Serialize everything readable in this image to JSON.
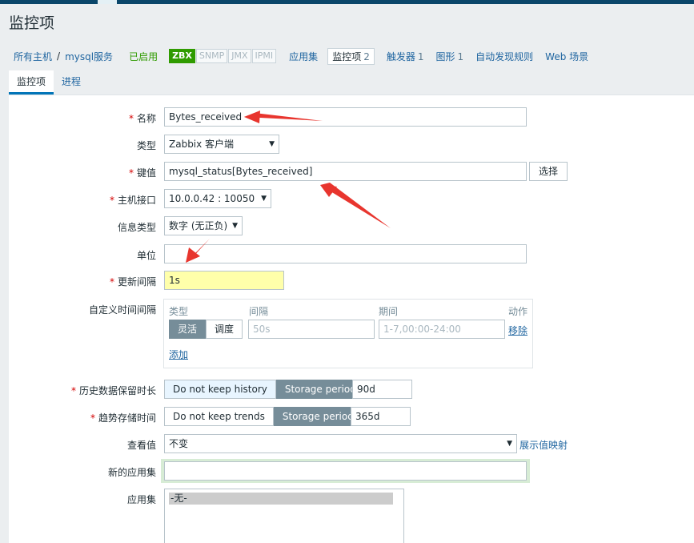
{
  "page": {
    "title": "监控项"
  },
  "breadcrumb": {
    "all_hosts": "所有主机",
    "separator": "/",
    "host": "mysql服务",
    "status": "已启用",
    "badges": [
      "ZBX",
      "SNMP",
      "JMX",
      "IPMI"
    ],
    "links": [
      {
        "label": "应用集",
        "count": ""
      },
      {
        "label": "监控项",
        "count": "2"
      },
      {
        "label": "触发器",
        "count": "1"
      },
      {
        "label": "图形",
        "count": "1"
      },
      {
        "label": "自动发现规则",
        "count": ""
      },
      {
        "label": "Web 场景",
        "count": ""
      }
    ]
  },
  "tabs": [
    "监控项",
    "进程"
  ],
  "form": {
    "name": {
      "label": "名称",
      "value": "Bytes_received"
    },
    "type": {
      "label": "类型",
      "value": "Zabbix 客户端"
    },
    "key": {
      "label": "键值",
      "value": "mysql_status[Bytes_received]",
      "button": "选择"
    },
    "interface": {
      "label": "主机接口",
      "value": "10.0.0.42 : 10050"
    },
    "info_type": {
      "label": "信息类型",
      "value": "数字 (无正负)"
    },
    "units": {
      "label": "单位",
      "value": ""
    },
    "interval": {
      "label": "更新间隔",
      "value": "1s"
    },
    "custom_intervals": {
      "label": "自定义时间间隔",
      "headers": {
        "type": "类型",
        "interval": "间隔",
        "period": "期间",
        "action": "动作"
      },
      "type_options": [
        "灵活",
        "调度"
      ],
      "interval_placeholder": "50s",
      "period_placeholder": "1-7,00:00-24:00",
      "remove": "移除",
      "add": "添加"
    },
    "history": {
      "label": "历史数据保留时长",
      "opt1": "Do not keep history",
      "opt2": "Storage period",
      "value": "90d"
    },
    "trends": {
      "label": "趋势存储时间",
      "opt1": "Do not keep trends",
      "opt2": "Storage period",
      "value": "365d"
    },
    "valuemap": {
      "label": "查看值",
      "value": "不变",
      "link": "展示值映射"
    },
    "new_app": {
      "label": "新的应用集",
      "value": ""
    },
    "apps": {
      "label": "应用集",
      "selected": "-无-"
    }
  },
  "colors": {
    "accent": "#0275b8",
    "required": "#d40000",
    "arrow": "#e8352e"
  }
}
